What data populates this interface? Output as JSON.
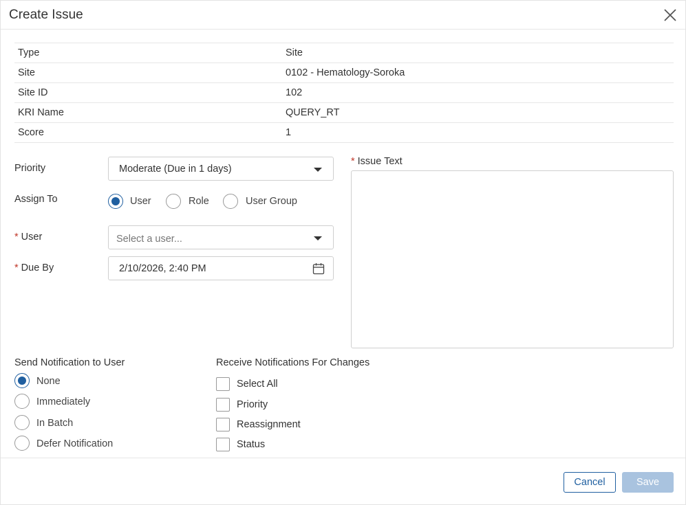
{
  "dialog": {
    "title": "Create Issue"
  },
  "info": {
    "rows": [
      {
        "label": "Type",
        "value": "Site"
      },
      {
        "label": "Site",
        "value": "0102 - Hematology-Soroka"
      },
      {
        "label": "Site ID",
        "value": "102"
      },
      {
        "label": "KRI Name",
        "value": "QUERY_RT"
      },
      {
        "label": "Score",
        "value": "1"
      }
    ]
  },
  "form": {
    "priority_label": "Priority",
    "priority_value": "Moderate (Due in 1 days)",
    "assign_to_label": "Assign To",
    "assign_options": [
      "User",
      "Role",
      "User Group"
    ],
    "assign_selected": "User",
    "user_label": "User",
    "user_placeholder": "Select a user...",
    "due_by_label": "Due By",
    "due_by_value": "2/10/2026, 2:40 PM",
    "issue_text_label": "Issue Text",
    "required_mark": "*"
  },
  "notify": {
    "send_label": "Send Notification to User",
    "send_options": [
      "None",
      "Immediately",
      "In Batch",
      "Defer Notification"
    ],
    "send_selected": "None",
    "receive_label": "Receive Notifications For Changes",
    "receive_options": [
      "Select All",
      "Priority",
      "Reassignment",
      "Status"
    ]
  },
  "footer": {
    "cancel_label": "Cancel",
    "save_label": "Save"
  },
  "colors": {
    "accent": "#1f5fa0",
    "required": "#c0392b",
    "save_disabled": "#a9c3df"
  }
}
